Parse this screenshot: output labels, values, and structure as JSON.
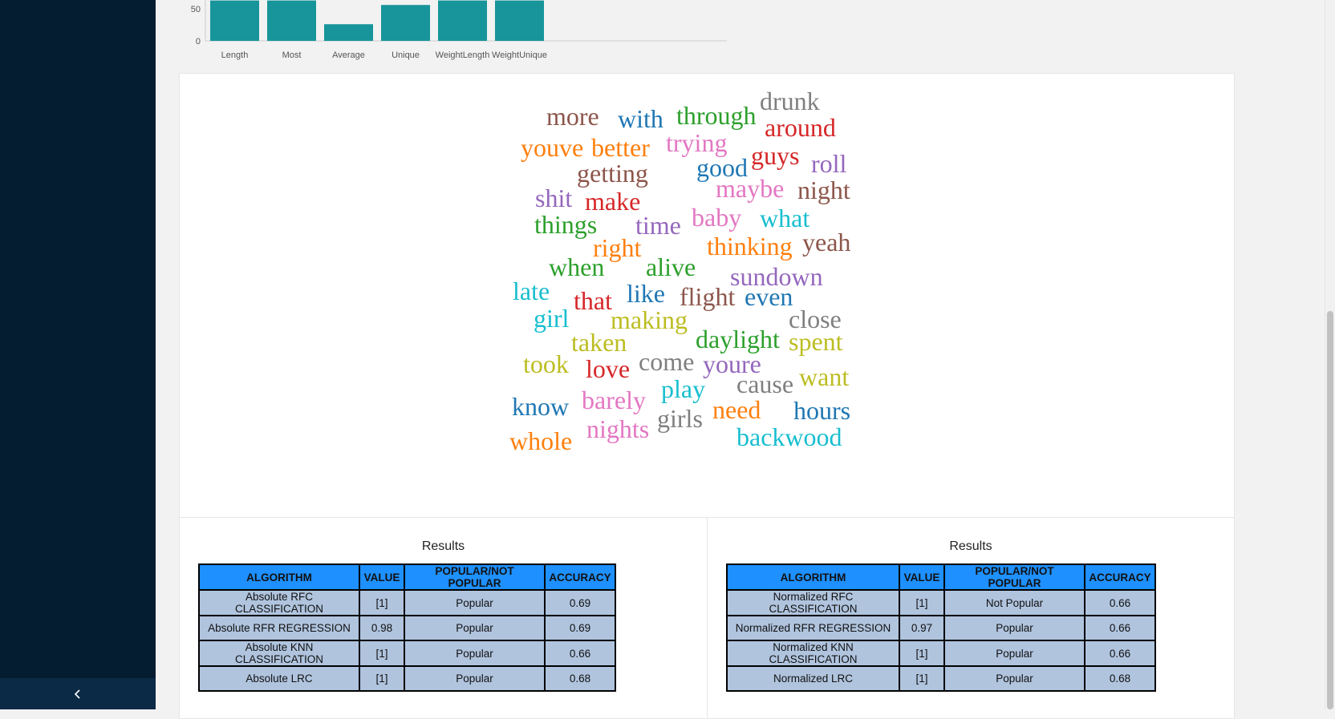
{
  "sidebar": {
    "collapse_icon": "chevron-left-icon"
  },
  "chart_data": {
    "type": "bar",
    "categories": [
      "Length",
      "Most",
      "Average",
      "Unique",
      "WeightLength",
      "WeightUnique"
    ],
    "values": [
      63,
      63,
      26,
      56,
      63,
      63
    ],
    "y_ticks": [
      "0",
      "50"
    ],
    "ylim": [
      0,
      63
    ],
    "bar_color": "#17959a",
    "title": "",
    "xlabel": "",
    "ylabel": ""
  },
  "wordcloud": {
    "words": [
      {
        "text": "more",
        "color": "#8c564b"
      },
      {
        "text": "with",
        "color": "#1f77b4"
      },
      {
        "text": "through",
        "color": "#2ca02c"
      },
      {
        "text": "drunk",
        "color": "#7f7f7f"
      },
      {
        "text": "around",
        "color": "#d62728"
      },
      {
        "text": "youve",
        "color": "#ff7f0e"
      },
      {
        "text": "better",
        "color": "#ff7f0e"
      },
      {
        "text": "trying",
        "color": "#e377c2"
      },
      {
        "text": "guys",
        "color": "#d62728"
      },
      {
        "text": "roll",
        "color": "#9467bd"
      },
      {
        "text": "getting",
        "color": "#8c564b"
      },
      {
        "text": "good",
        "color": "#1f77b4"
      },
      {
        "text": "shit",
        "color": "#9467bd"
      },
      {
        "text": "make",
        "color": "#d62728"
      },
      {
        "text": "maybe",
        "color": "#e377c2"
      },
      {
        "text": "night",
        "color": "#8c564b"
      },
      {
        "text": "things",
        "color": "#2ca02c"
      },
      {
        "text": "time",
        "color": "#9467bd"
      },
      {
        "text": "baby",
        "color": "#e377c2"
      },
      {
        "text": "what",
        "color": "#17becf"
      },
      {
        "text": "right",
        "color": "#ff7f0e"
      },
      {
        "text": "thinking",
        "color": "#ff7f0e"
      },
      {
        "text": "yeah",
        "color": "#8c564b"
      },
      {
        "text": "when",
        "color": "#2ca02c"
      },
      {
        "text": "alive",
        "color": "#2ca02c"
      },
      {
        "text": "sundown",
        "color": "#9467bd"
      },
      {
        "text": "late",
        "color": "#17becf"
      },
      {
        "text": "that",
        "color": "#d62728"
      },
      {
        "text": "like",
        "color": "#1f77b4"
      },
      {
        "text": "flight",
        "color": "#8c564b"
      },
      {
        "text": "even",
        "color": "#1f77b4"
      },
      {
        "text": "girl",
        "color": "#17becf"
      },
      {
        "text": "making",
        "color": "#bcbd22"
      },
      {
        "text": "close",
        "color": "#7f7f7f"
      },
      {
        "text": "taken",
        "color": "#bcbd22"
      },
      {
        "text": "daylight",
        "color": "#2ca02c"
      },
      {
        "text": "spent",
        "color": "#bcbd22"
      },
      {
        "text": "took",
        "color": "#bcbd22"
      },
      {
        "text": "love",
        "color": "#d62728"
      },
      {
        "text": "come",
        "color": "#7f7f7f"
      },
      {
        "text": "youre",
        "color": "#9467bd"
      },
      {
        "text": "cause",
        "color": "#7f7f7f"
      },
      {
        "text": "want",
        "color": "#bcbd22"
      },
      {
        "text": "know",
        "color": "#1f77b4"
      },
      {
        "text": "barely",
        "color": "#e377c2"
      },
      {
        "text": "play",
        "color": "#17becf"
      },
      {
        "text": "need",
        "color": "#ff7f0e"
      },
      {
        "text": "hours",
        "color": "#1f77b4"
      },
      {
        "text": "whole",
        "color": "#ff7f0e"
      },
      {
        "text": "nights",
        "color": "#e377c2"
      },
      {
        "text": "girls",
        "color": "#7f7f7f"
      },
      {
        "text": "backwood",
        "color": "#17becf"
      }
    ]
  },
  "results_left": {
    "title": "Results",
    "headers": [
      "ALGORITHM",
      "VALUE",
      "POPULAR/NOT POPULAR",
      "ACCURACY"
    ],
    "rows": [
      [
        "Absolute RFC CLASSIFICATION",
        "[1]",
        "Popular",
        "0.69"
      ],
      [
        "Absolute RFR REGRESSION",
        "0.98",
        "Popular",
        "0.69"
      ],
      [
        "Absolute KNN CLASSIFICATION",
        "[1]",
        "Popular",
        "0.66"
      ],
      [
        "Absolute LRC",
        "[1]",
        "Popular",
        "0.68"
      ]
    ]
  },
  "results_right": {
    "title": "Results",
    "headers": [
      "ALGORITHM",
      "VALUE",
      "POPULAR/NOT POPULAR",
      "ACCURACY"
    ],
    "rows": [
      [
        "Normalized RFC CLASSIFICATION",
        "[1]",
        "Not Popular",
        "0.66"
      ],
      [
        "Normalized RFR REGRESSION",
        "0.97",
        "Popular",
        "0.66"
      ],
      [
        "Normalized KNN CLASSIFICATION",
        "[1]",
        "Popular",
        "0.66"
      ],
      [
        "Normalized LRC",
        "[1]",
        "Popular",
        "0.68"
      ]
    ],
    "header_color": "#1e90ff",
    "cell_color": "#b0c4de"
  }
}
